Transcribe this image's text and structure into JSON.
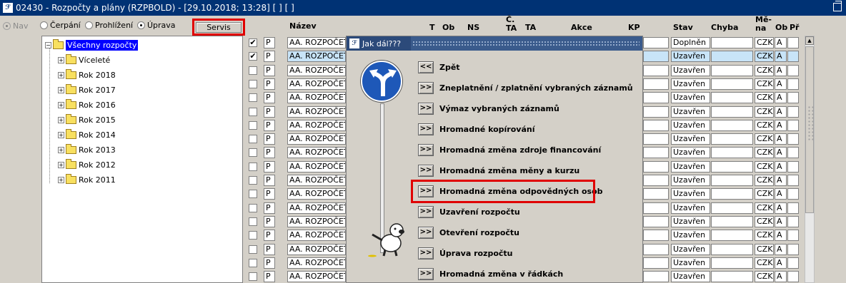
{
  "window": {
    "title": "02430 - Rozpočty a plány (RZPBOLD) - [29.10.2018; 13:28]  [ ]  [ ]",
    "icon": "app-logo-icon"
  },
  "nav": {
    "label": "Nav"
  },
  "modes": {
    "cerpani": "Čerpání",
    "prohlizeni": "Prohlížení",
    "uprava": "Úprava",
    "selected": "uprava"
  },
  "servis_button": "Servis",
  "tree": {
    "root": "Všechny rozpočty",
    "children": [
      "Víceleté",
      "Rok 2018",
      "Rok 2017",
      "Rok 2016",
      "Rok 2015",
      "Rok 2014",
      "Rok 2013",
      "Rok 2012",
      "Rok 2011"
    ]
  },
  "table": {
    "headers": {
      "nazev": "Název",
      "t": "T",
      "ob": "Ob",
      "ns": "NS",
      "cta": "Č. TA",
      "ta": "TA",
      "akce": "Akce",
      "kp": "KP",
      "stav": "Stav",
      "chyba": "Chyba",
      "mena": "Mě- na",
      "ob2": "Ob",
      "pr": "Př"
    },
    "rows": [
      {
        "checked": true,
        "p": "P",
        "nazev": "AA. ROZPOČET",
        "stav": "Doplněn",
        "mena": "CZK",
        "ob": "A"
      },
      {
        "checked": true,
        "p": "P",
        "nazev": "AA. ROZPOČET",
        "stav": "Uzavřen",
        "mena": "CZK",
        "ob": "A"
      },
      {
        "checked": false,
        "p": "P",
        "nazev": "AA. ROZPOČET",
        "stav": "Uzavřen",
        "mena": "CZK",
        "ob": "A"
      },
      {
        "checked": false,
        "p": "P",
        "nazev": "AA. ROZPOČET",
        "stav": "Uzavřen",
        "mena": "CZK",
        "ob": "A"
      },
      {
        "checked": false,
        "p": "P",
        "nazev": "AA. ROZPOČET",
        "stav": "Uzavřen",
        "mena": "CZK",
        "ob": "A"
      },
      {
        "checked": false,
        "p": "P",
        "nazev": "AA. ROZPOČET",
        "stav": "Uzavřen",
        "mena": "CZK",
        "ob": "A"
      },
      {
        "checked": false,
        "p": "P",
        "nazev": "AA. ROZPOČET",
        "stav": "Uzavřen",
        "mena": "CZK",
        "ob": "A"
      },
      {
        "checked": false,
        "p": "P",
        "nazev": "AA. ROZPOČET",
        "stav": "Uzavřen",
        "mena": "CZK",
        "ob": "A"
      },
      {
        "checked": false,
        "p": "P",
        "nazev": "AA. ROZPOČET",
        "stav": "Uzavřen",
        "mena": "CZK",
        "ob": "A"
      },
      {
        "checked": false,
        "p": "P",
        "nazev": "AA. ROZPOČET",
        "stav": "Uzavřen",
        "mena": "CZK",
        "ob": "A"
      },
      {
        "checked": false,
        "p": "P",
        "nazev": "AA. ROZPOČET",
        "stav": "Uzavřen",
        "mena": "CZK",
        "ob": "A"
      },
      {
        "checked": false,
        "p": "P",
        "nazev": "AA. ROZPOČET",
        "stav": "Uzavřen",
        "mena": "CZK",
        "ob": "A"
      },
      {
        "checked": false,
        "p": "P",
        "nazev": "AA. ROZPOČET",
        "stav": "Uzavřen",
        "mena": "CZK",
        "ob": "A"
      },
      {
        "checked": false,
        "p": "P",
        "nazev": "AA. ROZPOČET",
        "stav": "Uzavřen",
        "mena": "CZK",
        "ob": "A"
      },
      {
        "checked": false,
        "p": "P",
        "nazev": "AA. ROZPOČET",
        "stav": "Uzavřen",
        "mena": "CZK",
        "ob": "A"
      },
      {
        "checked": false,
        "p": "P",
        "nazev": "AA. ROZPOČET",
        "stav": "Uzavřen",
        "mena": "CZK",
        "ob": "A"
      },
      {
        "checked": false,
        "p": "P",
        "nazev": "AA. ROZPOČET",
        "stav": "Uzavřen",
        "mena": "CZK",
        "ob": "A"
      },
      {
        "checked": false,
        "p": "P",
        "nazev": "AA. ROZPOČET",
        "stav": "Uzavřen",
        "mena": "CZK",
        "ob": "A"
      }
    ]
  },
  "dialog": {
    "title": "Jak dál???",
    "items": [
      {
        "btn": "<<",
        "label": "Zpět"
      },
      {
        "btn": ">>",
        "label": "Zneplatnění / zplatnění vybraných záznamů"
      },
      {
        "btn": ">>",
        "label": "Výmaz vybraných záznamů"
      },
      {
        "btn": ">>",
        "label": "Hromadné kopírování"
      },
      {
        "btn": ">>",
        "label": "Hromadná změna zdroje financování"
      },
      {
        "btn": ">>",
        "label": "Hromadná změna měny a kurzu"
      },
      {
        "btn": ">>",
        "label": "Hromadná změna odpovědných osob"
      },
      {
        "btn": ">>",
        "label": "Uzavření rozpočtu"
      },
      {
        "btn": ">>",
        "label": "Otevření rozpočtu"
      },
      {
        "btn": ">>",
        "label": "Úprava rozpočtu"
      },
      {
        "btn": ">>",
        "label": "Hromadná změna v řádkách"
      }
    ],
    "highlighted_index": 6
  },
  "colors": {
    "highlight": "#e00000",
    "selection": "#0000ff",
    "title": "#003274",
    "row_selected": "#c8e4f8"
  }
}
